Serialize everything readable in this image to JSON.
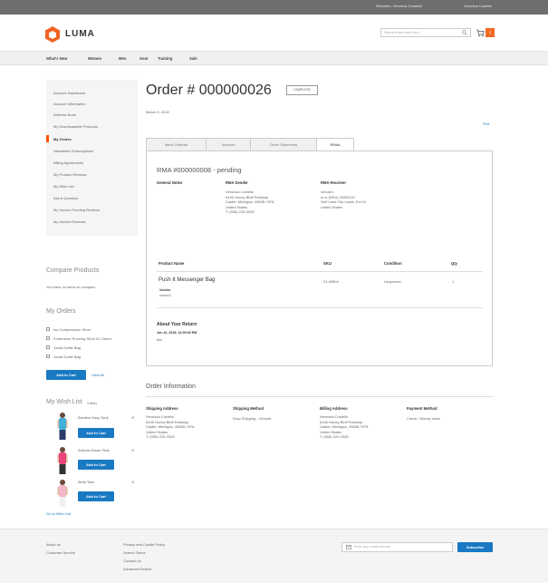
{
  "header": {
    "welcome": "Welcome, Veronica Costello!",
    "links": "Veronica Costello",
    "logo_text": "LUMA",
    "search_placeholder": "Search entire store here...",
    "cart_count": "2"
  },
  "nav": [
    "What's New",
    "Women",
    "Men",
    "Gear",
    "Training",
    "Sale"
  ],
  "sidebar": {
    "items": [
      {
        "label": "Account Dashboard",
        "active": false
      },
      {
        "label": "Account Information",
        "active": false
      },
      {
        "label": "Address Book",
        "active": false
      },
      {
        "label": "My Downloadable Products",
        "active": false
      },
      {
        "label": "My Orders",
        "active": true
      },
      {
        "label": "Newsletter Subscriptions",
        "active": false
      },
      {
        "label": "Billing Agreements",
        "active": false
      },
      {
        "label": "My Product Reviews",
        "active": false
      },
      {
        "label": "My Wish List",
        "active": false
      },
      {
        "label": "Ask A Question",
        "active": false
      },
      {
        "label": "My Vendor Pending Reviews",
        "active": false
      },
      {
        "label": "My Vendor Reviews",
        "active": false
      }
    ]
  },
  "compare": {
    "title": "Compare Products",
    "empty_text": "You have no items to compare."
  },
  "my_orders": {
    "title": "My Orders",
    "items": [
      "Ina Compression Short",
      "Endurance Running Short 02 Green",
      "Jovial Duffle Bag",
      "Jovial Duffle Bag"
    ],
    "add_to_cart": "Add to Cart",
    "view_all": "View All"
  },
  "wishlist": {
    "title": "My Wish List",
    "count": "3 items",
    "items": [
      {
        "name": "Breathe-Easy Tank"
      },
      {
        "name": "Antonia Racer Tank"
      },
      {
        "name": "Bella Tank"
      }
    ],
    "add_to_cart": "Add to Cart",
    "go_to": "Go to Wish List"
  },
  "order": {
    "title": "Order # 000000026",
    "status": "COMPLETE",
    "date": "March 9, 2018",
    "reorder": "Print",
    "tabs": [
      "Items Ordered",
      "Invoices",
      "Order Shipments",
      "RMAs"
    ],
    "active_tab": 3
  },
  "rma": {
    "title": "RMA #000000008 - pending",
    "general_notes_label": "General Notes",
    "sender_label": "RMA Sender",
    "sender_lines": [
      "Veronica Costello",
      "6146 Honey Bluff Parkway",
      "Calder, Michigan, 49628-7978",
      "United States",
      "T: (555) 229-3326"
    ],
    "receiver_label": "RMA Receiver",
    "receiver_lines": [
      "vendor1",
      "sr is (NSV) 00000157",
      "Gulf Land City Lewis, Ext 01",
      "United States"
    ],
    "columns": [
      "Product Name",
      "SKU",
      "Condition",
      "Qty"
    ],
    "product_name": "Push It Messenger Bag",
    "vendor_label": "Vendor",
    "vendor_value": "vendor1",
    "sku": "24-WB04",
    "condition": "Unopened",
    "qty": "1",
    "about_label": "About Your Return",
    "about_date": "Jun 16, 2018, 12:00:00 PM",
    "about_text": "test"
  },
  "order_info": {
    "title": "Order Information",
    "shipping_address_label": "Shipping Address",
    "shipping_address_lines": [
      "Veronica Costello",
      "6146 Honey Bluff Parkway",
      "Calder, Michigan, 49628-7978",
      "United States",
      "T: (555) 229-3326"
    ],
    "shipping_method_label": "Shipping Method",
    "shipping_method": "Drop Shipping - Ground",
    "billing_address_label": "Billing Address",
    "billing_address_lines": [
      "Veronica Costello",
      "6146 Honey Bluff Parkway",
      "Calder, Michigan, 49628-7978",
      "United States",
      "T: (555) 229-3326"
    ],
    "payment_method_label": "Payment Method",
    "payment_method": "Check / Money order"
  },
  "footer": {
    "col1": [
      "About us",
      "Customer Service"
    ],
    "col2": [
      "Privacy and Cookie Policy",
      "Search Terms",
      "Contact Us",
      "Advanced Search"
    ],
    "email_placeholder": "Enter your email address",
    "subscribe": "Subscribe"
  },
  "colors": {
    "accent": "#1979c3",
    "brand": "#ff5501",
    "cart": "#f06a23"
  }
}
